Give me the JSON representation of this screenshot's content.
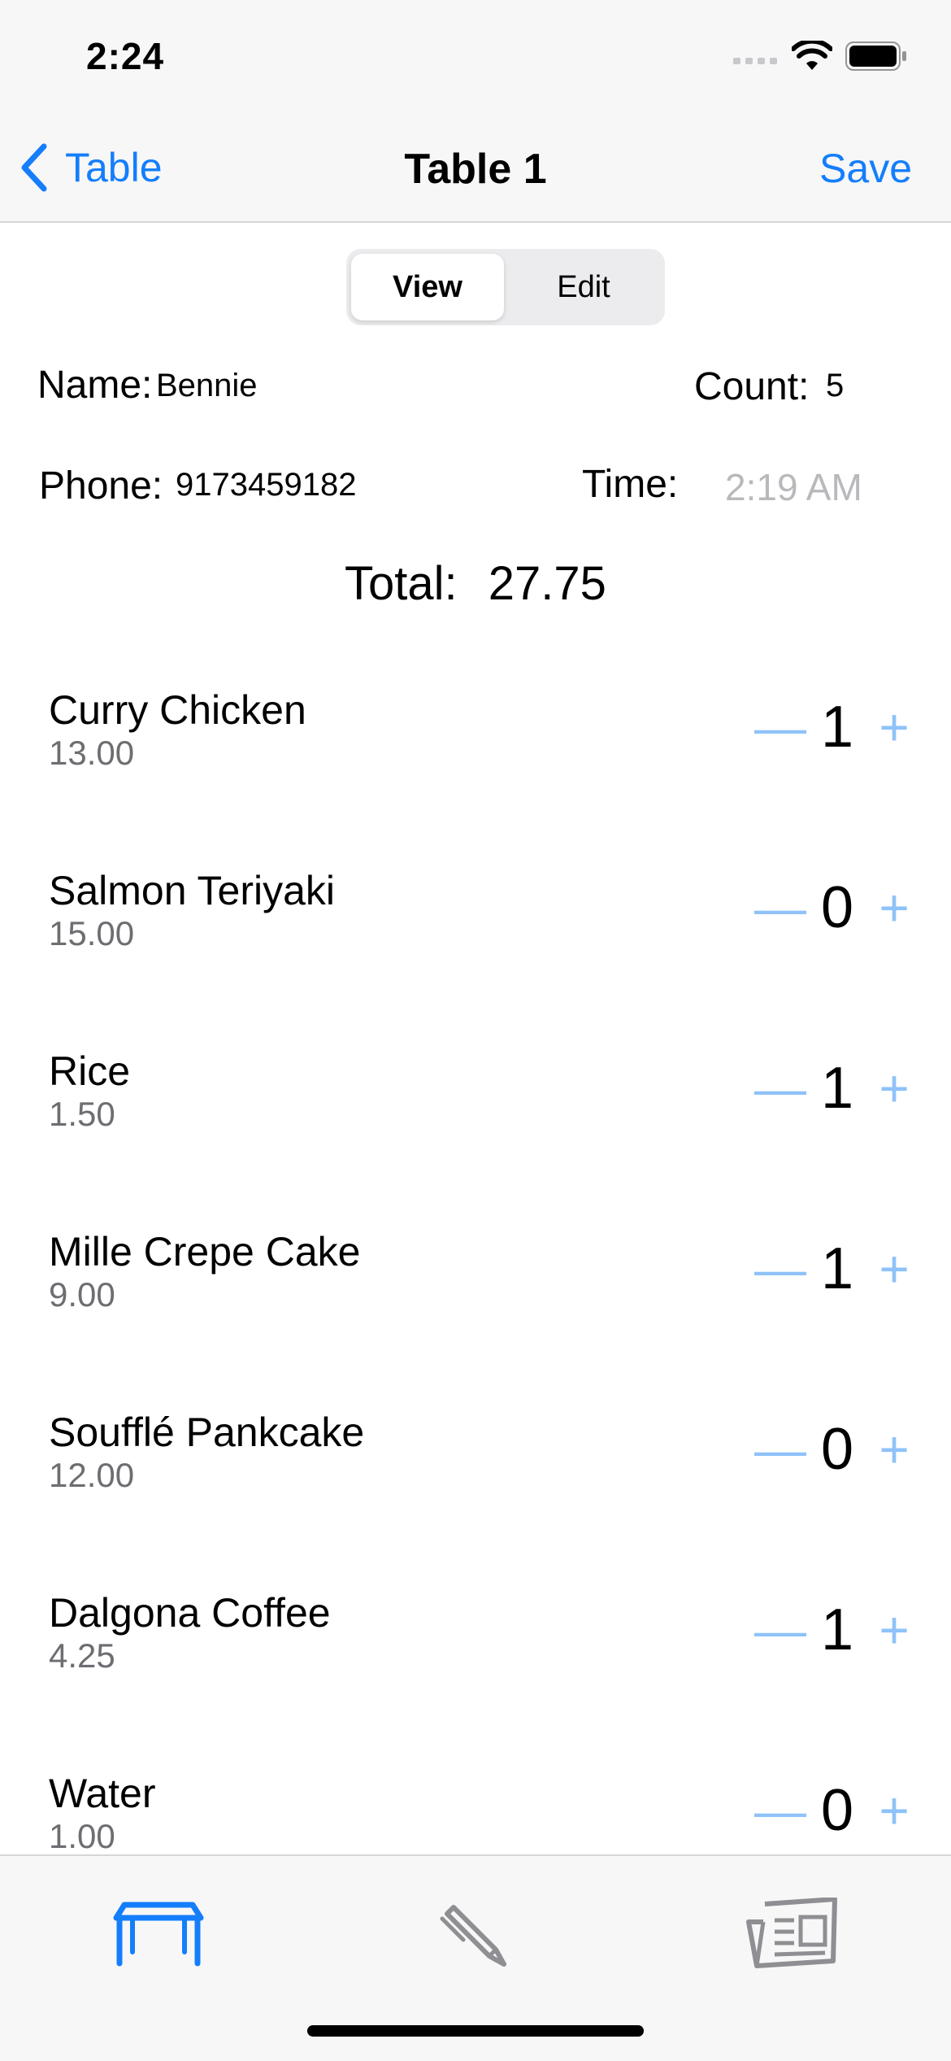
{
  "status_bar": {
    "time": "2:24"
  },
  "nav": {
    "back_label": "Table",
    "title": "Table 1",
    "save_label": "Save"
  },
  "segmented": {
    "options": [
      "View",
      "Edit"
    ],
    "selected": "View"
  },
  "details": {
    "name_label": "Name:",
    "name_value": "Bennie",
    "count_label": "Count:",
    "count_value": "5",
    "phone_label": "Phone:",
    "phone_value": "9173459182",
    "time_label": "Time:",
    "time_value": "2:19 AM",
    "total_label": "Total:",
    "total_value": "27.75"
  },
  "menu_items": [
    {
      "name": "Curry Chicken",
      "price": "13.00",
      "qty": "1"
    },
    {
      "name": "Salmon Teriyaki",
      "price": "15.00",
      "qty": "0"
    },
    {
      "name": "Rice",
      "price": "1.50",
      "qty": "1"
    },
    {
      "name": "Mille Crepe Cake",
      "price": "9.00",
      "qty": "1"
    },
    {
      "name": "Soufflé Pankcake",
      "price": "12.00",
      "qty": "0"
    },
    {
      "name": "Dalgona Coffee",
      "price": "4.25",
      "qty": "1"
    },
    {
      "name": "Water",
      "price": "1.00",
      "qty": "0"
    }
  ],
  "stepper": {
    "minus": "—",
    "plus": "+"
  },
  "tabs": [
    {
      "icon": "table-icon",
      "active": true
    },
    {
      "icon": "pencil-icon",
      "active": false
    },
    {
      "icon": "newspaper-icon",
      "active": false
    }
  ],
  "colors": {
    "accent": "#147efb",
    "stepper": "#8fc2f9",
    "inactive_icon": "#8e8e93"
  }
}
